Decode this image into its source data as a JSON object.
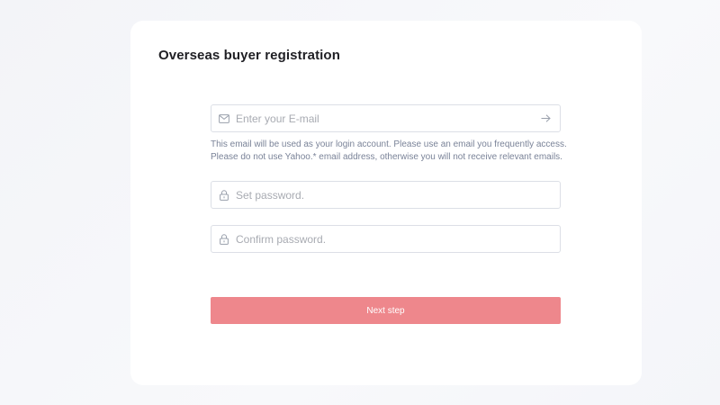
{
  "form": {
    "title": "Overseas buyer registration",
    "email": {
      "placeholder": "Enter your E-mail",
      "value": "",
      "icon": "mail-icon",
      "submit_icon": "arrow-right-icon"
    },
    "email_hint": [
      "This email will be used as your login account. Please use an email you frequently access.",
      "Please do not use Yahoo.* email address, otherwise you will not receive relevant emails."
    ],
    "password": {
      "placeholder": "Set password.",
      "value": "",
      "icon": "lock-icon"
    },
    "confirm_password": {
      "placeholder": "Confirm password.",
      "value": "",
      "icon": "lock-icon"
    },
    "next_button": {
      "label": "Next step",
      "color": "#ee878c"
    }
  }
}
